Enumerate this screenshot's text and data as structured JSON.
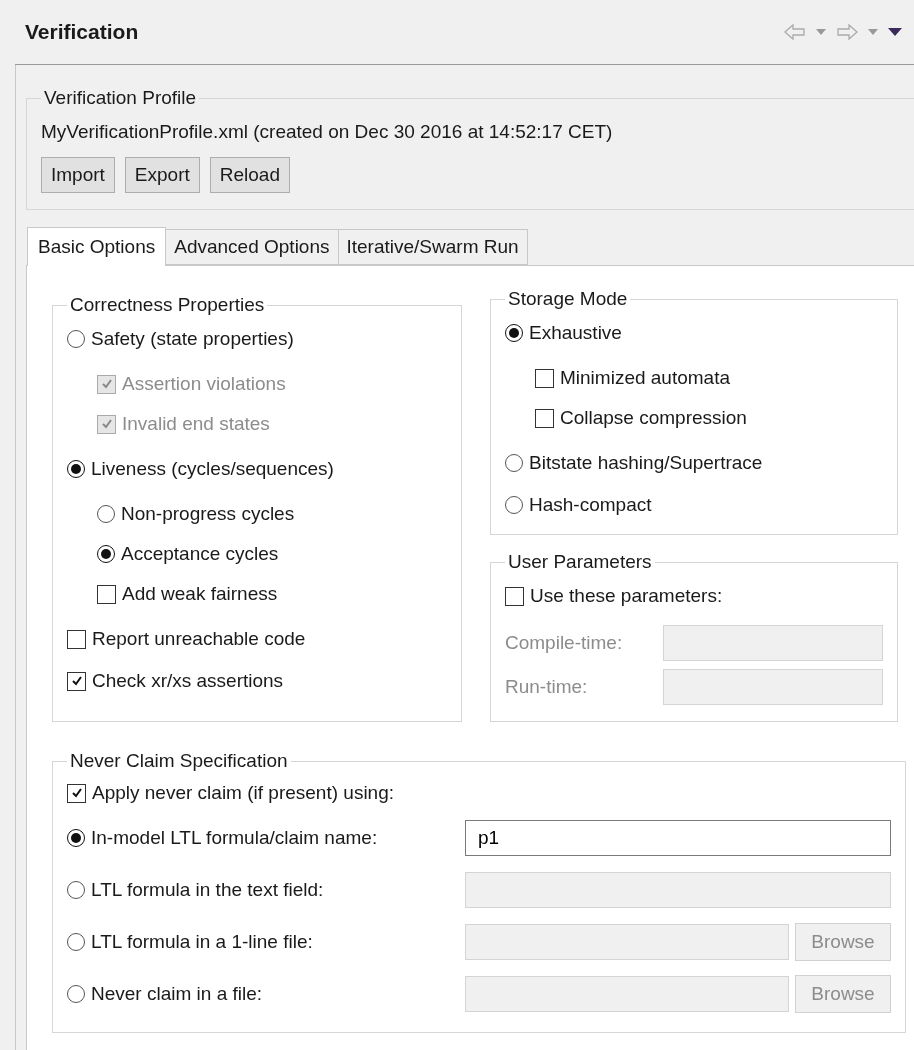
{
  "view": {
    "title": "Verification"
  },
  "profile": {
    "legend": "Verification Profile",
    "file": "MyVerificationProfile.xml (created on Dec 30 2016 at 14:52:17 CET)",
    "buttons": [
      "Import",
      "Export",
      "Reload"
    ]
  },
  "tabs": [
    {
      "label": "Basic Options",
      "selected": true
    },
    {
      "label": "Advanced Options",
      "selected": false
    },
    {
      "label": "Iterative/Swarm Run",
      "selected": false
    }
  ],
  "correctness": {
    "legend": "Correctness Properties",
    "options": [
      {
        "kind": "radio",
        "label": "Safety (state properties)",
        "selected": false,
        "children": [
          {
            "kind": "checkbox",
            "label": "Assertion violations",
            "checked": true,
            "disabled": true
          },
          {
            "kind": "checkbox",
            "label": "Invalid end states",
            "checked": true,
            "disabled": true
          }
        ]
      },
      {
        "kind": "radio",
        "label": "Liveness (cycles/sequences)",
        "selected": true,
        "children": [
          {
            "kind": "radio",
            "label": "Non-progress cycles",
            "selected": false
          },
          {
            "kind": "radio",
            "label": "Acceptance cycles",
            "selected": true
          },
          {
            "kind": "checkbox",
            "label": "Add weak fairness",
            "checked": false
          }
        ]
      },
      {
        "kind": "checkbox",
        "label": "Report unreachable code",
        "checked": false
      },
      {
        "kind": "checkbox",
        "label": "Check xr/xs assertions",
        "checked": true
      }
    ]
  },
  "storage": {
    "legend": "Storage Mode",
    "options": [
      {
        "kind": "radio",
        "label": "Exhaustive",
        "selected": true,
        "children": [
          {
            "kind": "checkbox",
            "label": "Minimized automata",
            "checked": false
          },
          {
            "kind": "checkbox",
            "label": "Collapse compression",
            "checked": false
          }
        ]
      },
      {
        "kind": "radio",
        "label": "Bitstate hashing/Supertrace",
        "selected": false
      },
      {
        "kind": "radio",
        "label": "Hash-compact",
        "selected": false
      }
    ]
  },
  "user_parameters": {
    "legend": "User Parameters",
    "use": {
      "label": "Use these parameters:",
      "checked": false
    },
    "fields": [
      {
        "label": "Compile-time:",
        "disabled": true
      },
      {
        "label": "Run-time:",
        "disabled": true
      }
    ]
  },
  "never_claim": {
    "legend": "Never Claim Specification",
    "apply": {
      "label": "Apply never claim (if present) using:",
      "checked": true
    },
    "options": [
      {
        "label": "In-model LTL formula/claim name:",
        "selected": true,
        "value": "p1",
        "disabled": false
      },
      {
        "label": "LTL formula in the text field:",
        "selected": false,
        "disabled": true
      },
      {
        "label": "LTL formula in a 1-line file:",
        "selected": false,
        "disabled": true,
        "browse": "Browse"
      },
      {
        "label": "Never claim in a file:",
        "selected": false,
        "disabled": true,
        "browse": "Browse"
      }
    ]
  }
}
